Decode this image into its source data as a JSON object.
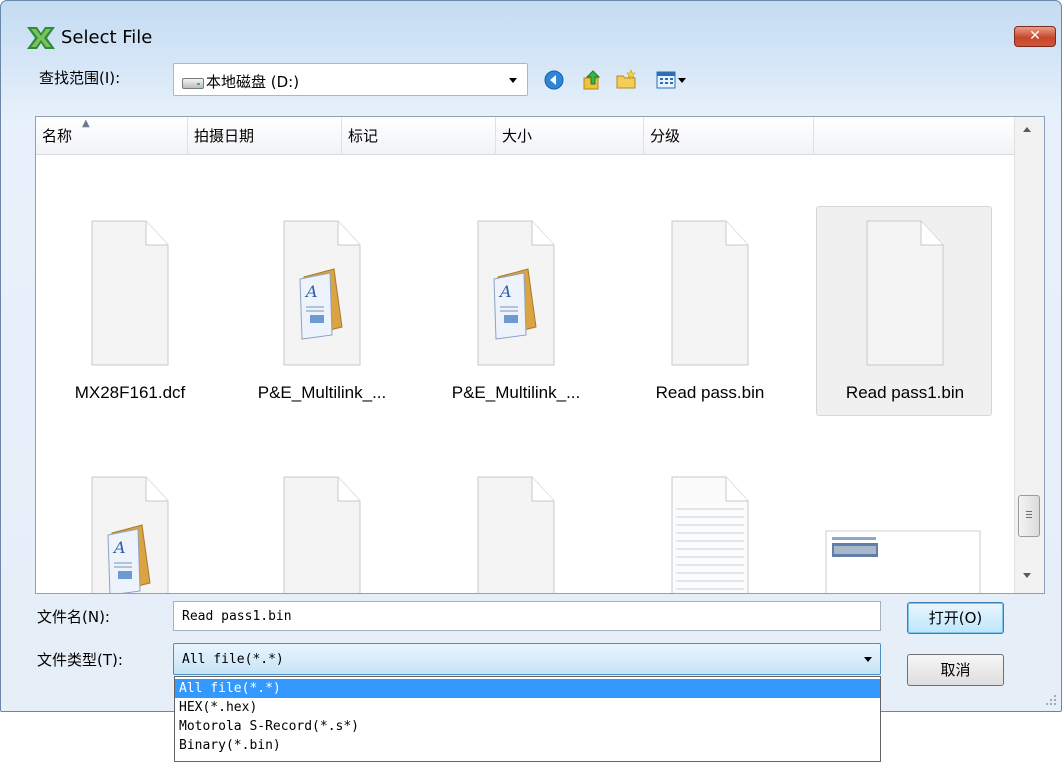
{
  "window": {
    "title": "Select File",
    "close_label": "✕"
  },
  "lookin": {
    "label": "查找范围(I):",
    "value": "本地磁盘 (D:)"
  },
  "columns": [
    "名称",
    "拍摄日期",
    "标记",
    "大小",
    "分级"
  ],
  "files": [
    {
      "name": "MX28F161.dcf",
      "icon": "blank-file-icon"
    },
    {
      "name": "P&E_Multilink_...",
      "icon": "document-file-icon"
    },
    {
      "name": "P&E_Multilink_...",
      "icon": "document-file-icon"
    },
    {
      "name": "Read pass.bin",
      "icon": "blank-file-icon"
    },
    {
      "name": "Read pass1.bin",
      "icon": "blank-file-icon",
      "selected": true
    },
    {
      "name": "",
      "icon": "document-file-icon"
    },
    {
      "name": "",
      "icon": "blank-file-icon"
    },
    {
      "name": "",
      "icon": "blank-file-icon"
    },
    {
      "name": "",
      "icon": "text-file-icon"
    },
    {
      "name": "",
      "icon": "image-thumbnail-icon"
    }
  ],
  "filename": {
    "label": "文件名(N):",
    "value": "Read pass1.bin"
  },
  "filetype": {
    "label": "文件类型(T):",
    "value": "All file(*.*)",
    "options": [
      "All file(*.*)",
      "HEX(*.hex)",
      "Motorola S-Record(*.s*)",
      "Binary(*.bin)"
    ]
  },
  "buttons": {
    "open": "打开(O)",
    "cancel": "取消"
  },
  "colors": {
    "selection": "#3399ff",
    "close": "#c7472b",
    "frame": "#c4dcf2"
  }
}
